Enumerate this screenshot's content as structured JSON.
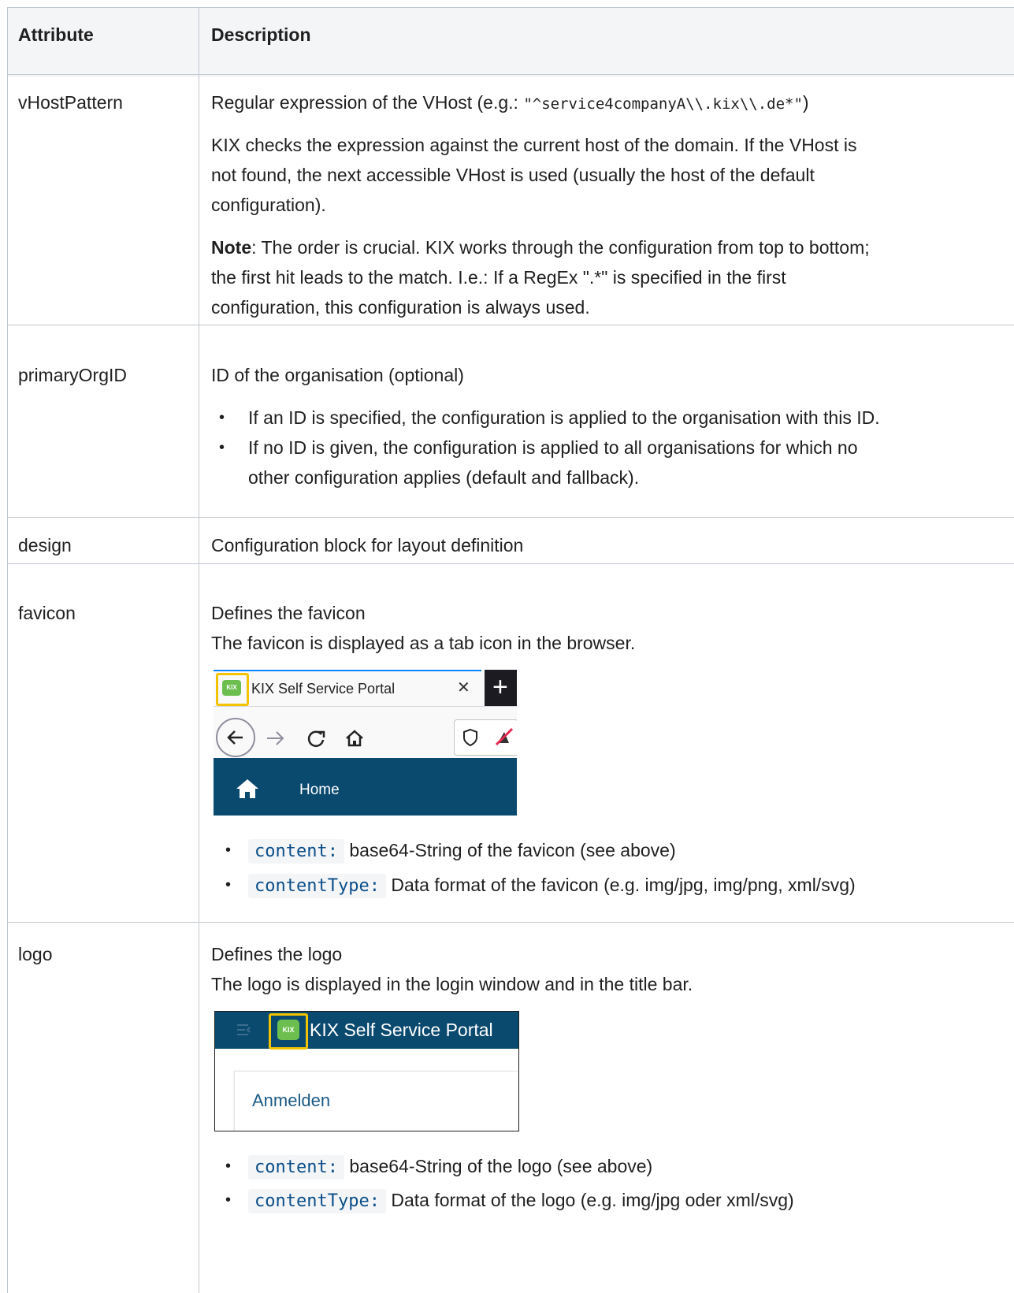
{
  "header": {
    "attribute": "Attribute",
    "description": "Description"
  },
  "rows": {
    "vhost": {
      "name": "vHostPattern",
      "line1_text": "Regular expression of the VHost (e.g.: ",
      "line1_code": "\"^service4companyA\\\\.kix\\\\.de*\"",
      "line1_end": ")",
      "p2_l1": "KIX checks the expression against the current host of the domain. If the VHost is",
      "p2_l2": "not found, the next accessible VHost is used (usually the host of the default",
      "p2_l3": "configuration).",
      "note_label": "Note",
      "p3_l1": ": The order is crucial. KIX works through the configuration from top to bottom;",
      "p3_l2": "the first hit leads to the match. I.e.: If a RegEx \".*\" is specified in the first",
      "p3_l3": "configuration, this configuration is always used."
    },
    "org": {
      "name": "primaryOrgID",
      "desc": "ID of the organisation (optional)",
      "b1": "If an ID is specified, the configuration is applied to the organisation with this ID.",
      "b2_l1": "If no ID is given, the configuration is applied to all organisations for which no",
      "b2_l2": "other configuration applies (default and fallback)."
    },
    "design": {
      "name": "design",
      "desc": "Configuration block for layout definition"
    },
    "favicon": {
      "name": "favicon",
      "l1": "Defines the favicon",
      "l2": "The favicon is displayed as a tab icon in the browser.",
      "shot_tab_title": "KIX Self Service Portal",
      "shot_close": "✕",
      "shot_plus": "+",
      "shot_home": "Home",
      "shot_kix": "KIX",
      "b1_code": "content:",
      "b1_text": "base64-String of the favicon (see above)",
      "b2_code": "contentType:",
      "b2_text": "Data format of the favicon (e.g. img/jpg, img/png, xml/svg)"
    },
    "logo": {
      "name": "logo",
      "l1": "Defines the logo",
      "l2": "The logo is displayed in the login window and in the title bar.",
      "shot_title": "KIX Self Service Portal",
      "shot_login": "Anmelden",
      "shot_kix": "KIX",
      "b1_code": "content:",
      "b1_text": "base64-String of the logo (see above)",
      "b2_code": "contentType:",
      "b2_text": "Data format of the logo (e.g. img/jpg oder xml/svg)"
    }
  },
  "colors": {
    "header_bg": "#f4f5f7",
    "border": "#c1c7d0",
    "code_text": "#0b4f8a",
    "highlight": "#f2c300",
    "kix_green": "#6cbf4f",
    "nav_blue": "#0b4a6f"
  }
}
